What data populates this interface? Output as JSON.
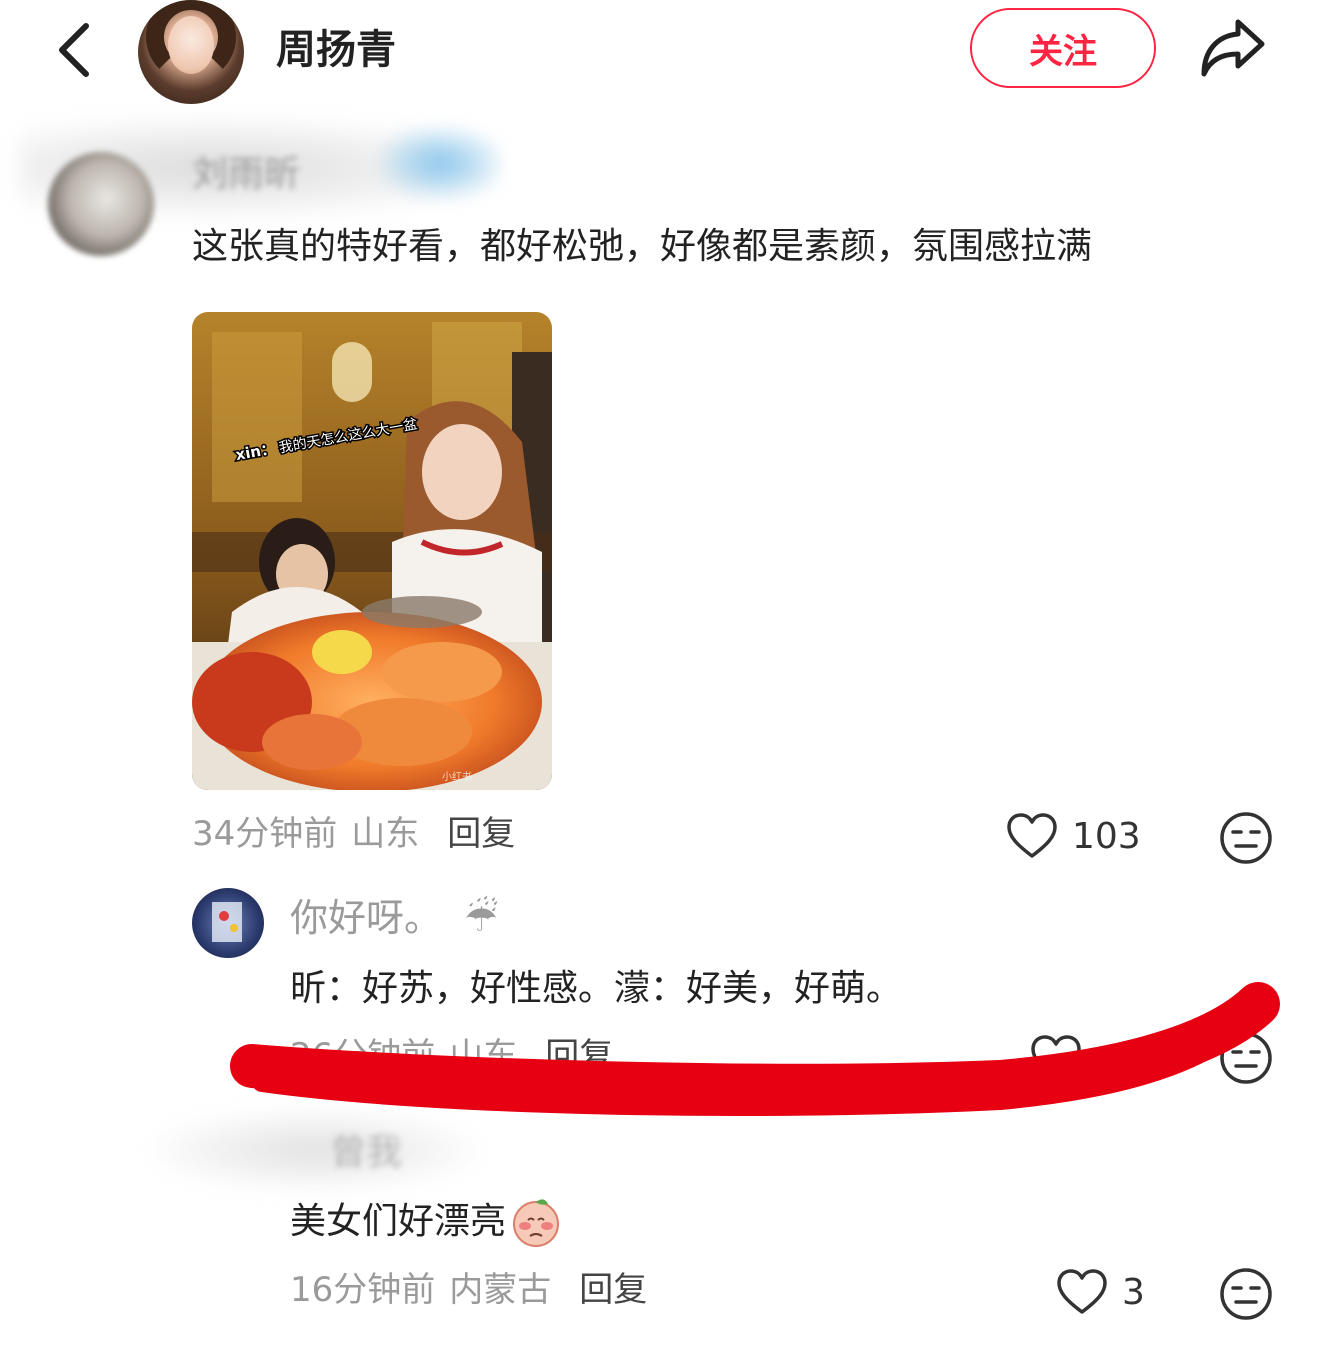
{
  "header": {
    "user_name": "周扬青",
    "follow_label": "关注",
    "back_icon": "chevron-left-icon",
    "share_icon": "share-arrow-icon"
  },
  "comments": [
    {
      "author": "刘雨昕",
      "author_blurred": true,
      "text": "这张真的特好看，都好松弛，好像都是素颜，氛围感拉满",
      "image": {
        "caption_name": "xin：",
        "caption_text": "我的天怎么这么大一盆",
        "watermark": "小红书"
      },
      "time": "34分钟前",
      "location": "山东",
      "reply_label": "回复",
      "likes": "103"
    },
    {
      "author": "你好呀。",
      "author_emoji": "☔",
      "text": "昕：好苏，好性感。濛：好美，好萌。",
      "time": "26分钟前",
      "location": "山东",
      "reply_label": "回复"
    },
    {
      "author": "曾我",
      "author_blurred": true,
      "text": "美女们好漂亮",
      "time": "16分钟前",
      "location": "内蒙古",
      "reply_label": "回复",
      "likes": "3"
    }
  ],
  "colors": {
    "accent": "#ff2442",
    "marker": "#e60012",
    "text_primary": "#222222",
    "text_secondary": "#9a9a9a"
  }
}
